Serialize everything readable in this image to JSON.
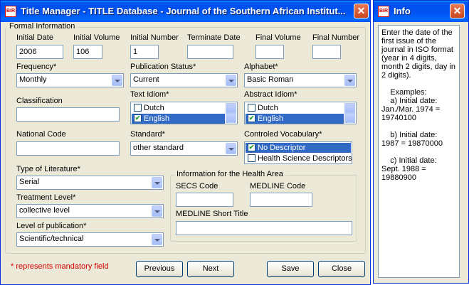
{
  "main_window": {
    "title": "Title Manager - TITLE Database - Journal of the Southern African Institut...",
    "app_icon": "bireme-logo-icon",
    "close_glyph": "✕"
  },
  "formal_info": {
    "group_title": "Formal Information",
    "initial_date_label": "Initial Date",
    "initial_date_value": "2006",
    "initial_volume_label": "Initial Volume",
    "initial_volume_value": "106",
    "initial_number_label": "Initial Number",
    "initial_number_value": "1",
    "terminate_date_label": "Terminate Date",
    "terminate_date_value": "",
    "final_volume_label": "Final Volume",
    "final_volume_value": "",
    "final_number_label": "Final Number",
    "final_number_value": "",
    "frequency_label": "Frequency*",
    "frequency_value": "Monthly",
    "publication_status_label": "Publication Status*",
    "publication_status_value": "Current",
    "alphabet_label": "Alphabet*",
    "alphabet_value": "Basic Roman",
    "classification_label": "Classification",
    "classification_value": "",
    "text_idiom_label": "Text Idiom*",
    "text_idiom_items": [
      {
        "label": "Dutch",
        "checked": false,
        "selected": false
      },
      {
        "label": "English",
        "checked": true,
        "selected": true
      }
    ],
    "abstract_idiom_label": "Abstract Idiom*",
    "abstract_idiom_items": [
      {
        "label": "Dutch",
        "checked": false,
        "selected": false
      },
      {
        "label": "English",
        "checked": true,
        "selected": true
      }
    ],
    "national_code_label": "National Code",
    "national_code_value": "",
    "standard_label": "Standard*",
    "standard_value": "other standard",
    "controlled_vocab_label": "Controled Vocabulary*",
    "controlled_vocab_items": [
      {
        "label": "No Descriptor",
        "checked": true,
        "selected": true
      },
      {
        "label": "Health Science Descriptors",
        "checked": false,
        "selected": false
      }
    ],
    "type_of_literature_label": "Type of Literature*",
    "type_of_literature_value": "Serial",
    "treatment_level_label": "Treatment Level*",
    "treatment_level_value": "collective level",
    "level_of_publication_label": "Level of publication*",
    "level_of_publication_value": "Scientific/technical"
  },
  "health_area": {
    "group_title": "Information for the Health Area",
    "secs_code_label": "SECS Code",
    "secs_code_value": "",
    "medline_code_label": "MEDLINE Code",
    "medline_code_value": "",
    "medline_short_title_label": "MEDLINE Short Title",
    "medline_short_title_value": ""
  },
  "footer": {
    "mandatory_note": "* represents mandatory field",
    "previous_label": "Previous",
    "next_label": "Next",
    "save_label": "Save",
    "close_label": "Close"
  },
  "info_window": {
    "title": "Info",
    "close_glyph": "✕",
    "text": "Enter the date of the first issue of the journal in ISO format (year in 4 digits, month 2 digits, day in 2 digits).\n\n    Examples:\n    a) Initial date: Jan./Mar. 1974 = 19740100\n\n    b) Initial date: 1987 = 19870000\n\n    c) Initial date: Sept. 1988 = 19880900"
  },
  "colors": {
    "titlebar": "#0055ea",
    "selection": "#316ac5",
    "mandatory_note": "#d40000",
    "window_face": "#ece9d8"
  }
}
